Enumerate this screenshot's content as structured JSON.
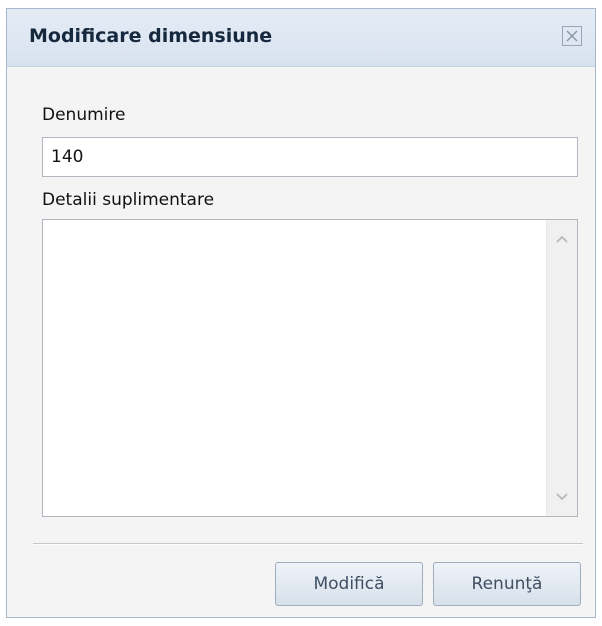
{
  "dialog": {
    "title": "Modificare dimensiune",
    "close_icon": "close-icon"
  },
  "form": {
    "name_label": "Denumire",
    "name_value": "140",
    "details_label": "Detalii suplimentare",
    "details_value": ""
  },
  "buttons": {
    "modify_label": "Modifică",
    "cancel_label": "Renunţă"
  }
}
